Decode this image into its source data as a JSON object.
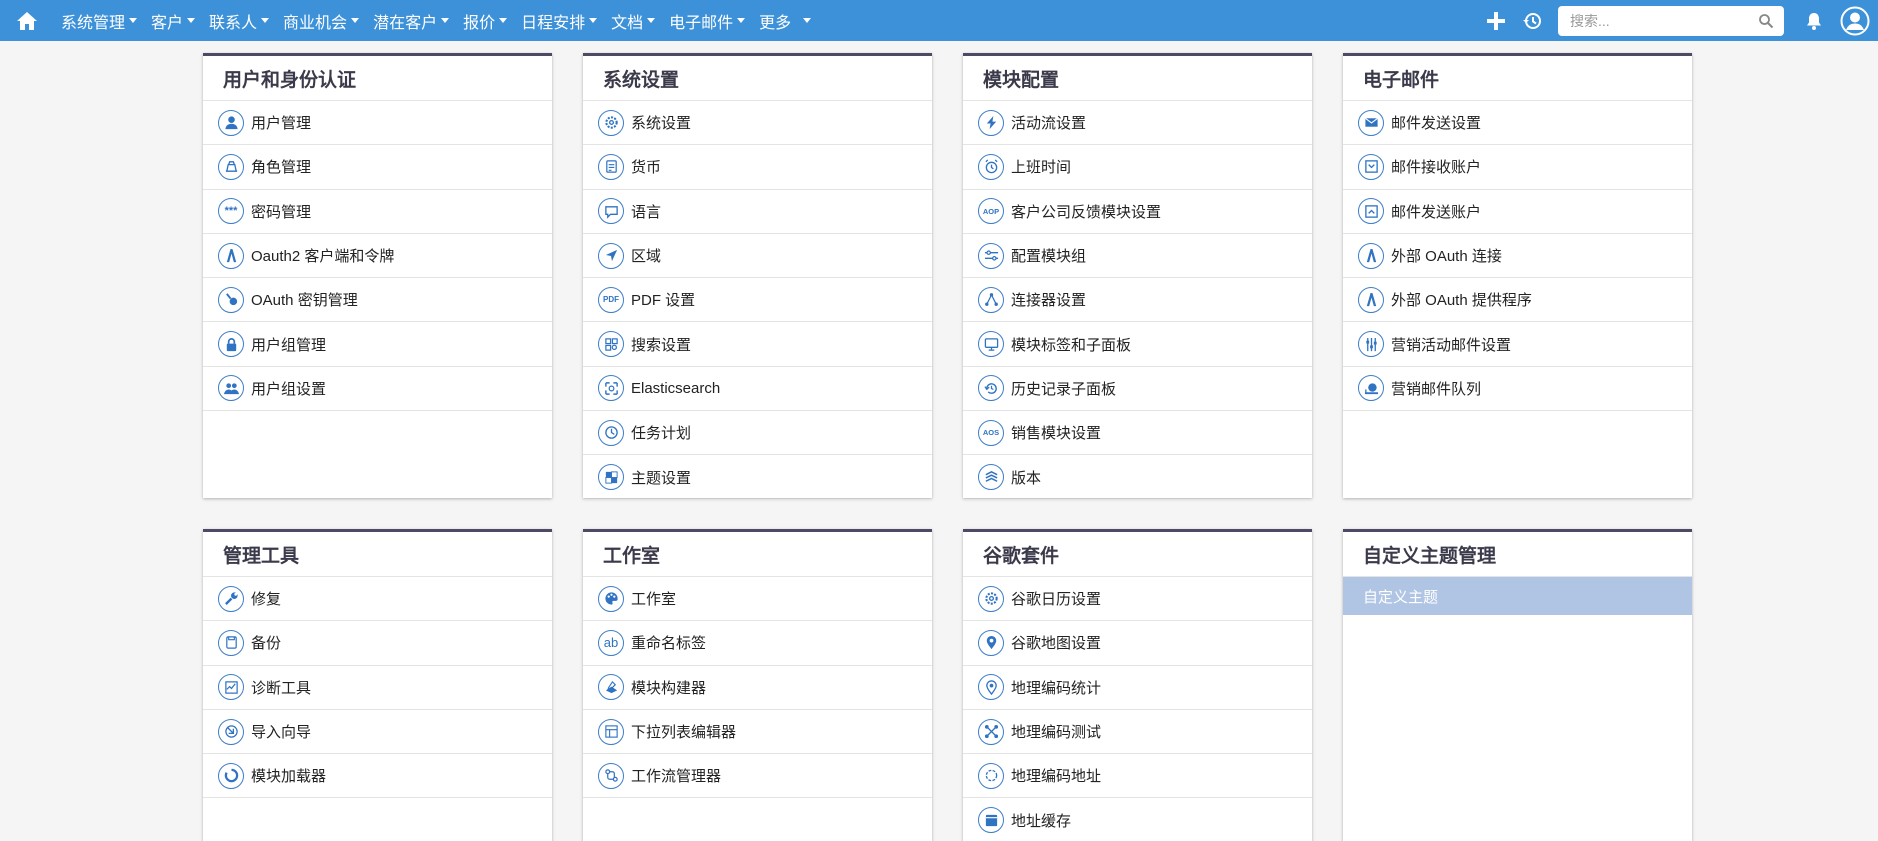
{
  "nav": {
    "menus": [
      "系统管理",
      "客户",
      "联系人",
      "商业机会",
      "潜在客户",
      "报价",
      "日程安排",
      "文档",
      "电子邮件",
      "更多"
    ],
    "search_placeholder": "搜索..."
  },
  "panels": [
    {
      "title": "用户和身份认证",
      "items": [
        {
          "label": "用户管理",
          "icon": "user-icon"
        },
        {
          "label": "角色管理",
          "icon": "role-icon"
        },
        {
          "label": "密码管理",
          "icon": "password-icon"
        },
        {
          "label": "Oauth2 客户端和令牌",
          "icon": "oauth-client-icon"
        },
        {
          "label": "OAuth 密钥管理",
          "icon": "key-icon"
        },
        {
          "label": "用户组管理",
          "icon": "lock-icon"
        },
        {
          "label": "用户组设置",
          "icon": "group-icon"
        }
      ]
    },
    {
      "title": "系统设置",
      "items": [
        {
          "label": "系统设置",
          "icon": "gear-icon"
        },
        {
          "label": "货币",
          "icon": "currency-icon"
        },
        {
          "label": "语言",
          "icon": "speech-bubble-icon"
        },
        {
          "label": "区域",
          "icon": "location-arrow-icon"
        },
        {
          "label": "PDF 设置",
          "icon": "pdf-icon"
        },
        {
          "label": "搜索设置",
          "icon": "search-settings-icon"
        },
        {
          "label": "Elasticsearch",
          "icon": "elasticsearch-icon"
        },
        {
          "label": "任务计划",
          "icon": "clock-icon"
        },
        {
          "label": "主题设置",
          "icon": "theme-icon"
        }
      ]
    },
    {
      "title": "模块配置",
      "items": [
        {
          "label": "活动流设置",
          "icon": "lightning-icon"
        },
        {
          "label": "上班时间",
          "icon": "alarm-clock-icon"
        },
        {
          "label": "客户公司反馈模块设置",
          "icon": "aop-icon"
        },
        {
          "label": "配置模块组",
          "icon": "sliders-icon"
        },
        {
          "label": "连接器设置",
          "icon": "connector-icon"
        },
        {
          "label": "模块标签和子面板",
          "icon": "monitor-icon"
        },
        {
          "label": "历史记录子面板",
          "icon": "history-icon"
        },
        {
          "label": "销售模块设置",
          "icon": "aos-icon"
        },
        {
          "label": "版本",
          "icon": "layers-icon"
        }
      ]
    },
    {
      "title": "电子邮件",
      "items": [
        {
          "label": "邮件发送设置",
          "icon": "envelope-icon"
        },
        {
          "label": "邮件接收账户",
          "icon": "inbox-icon"
        },
        {
          "label": "邮件发送账户",
          "icon": "outbox-icon"
        },
        {
          "label": "外部 OAuth 连接",
          "icon": "oauth-connect-icon"
        },
        {
          "label": "外部 OAuth 提供程序",
          "icon": "oauth-provider-icon"
        },
        {
          "label": "营销活动邮件设置",
          "icon": "campaign-sliders-icon"
        },
        {
          "label": "营销邮件队列",
          "icon": "snail-icon"
        }
      ]
    },
    {
      "title": "管理工具",
      "items": [
        {
          "label": "修复",
          "icon": "wrench-icon"
        },
        {
          "label": "备份",
          "icon": "backup-icon"
        },
        {
          "label": "诊断工具",
          "icon": "diagnostic-icon"
        },
        {
          "label": "导入向导",
          "icon": "import-icon"
        },
        {
          "label": "模块加载器",
          "icon": "loader-icon"
        }
      ]
    },
    {
      "title": "工作室",
      "items": [
        {
          "label": "工作室",
          "icon": "palette-icon"
        },
        {
          "label": "重命名标签",
          "icon": "ab-icon"
        },
        {
          "label": "模块构建器",
          "icon": "builder-icon"
        },
        {
          "label": "下拉列表编辑器",
          "icon": "dropdown-icon"
        },
        {
          "label": "工作流管理器",
          "icon": "workflow-icon"
        }
      ]
    },
    {
      "title": "谷歌套件",
      "items": [
        {
          "label": "谷歌日历设置",
          "icon": "calendar-gear-icon"
        },
        {
          "label": "谷歌地图设置",
          "icon": "map-pin-icon"
        },
        {
          "label": "地理编码统计",
          "icon": "geo-stats-icon"
        },
        {
          "label": "地理编码测试",
          "icon": "geo-test-icon"
        },
        {
          "label": "地理编码地址",
          "icon": "geo-address-icon"
        },
        {
          "label": "地址缓存",
          "icon": "cache-icon"
        }
      ]
    },
    {
      "title": "自定义主题管理",
      "items": [
        {
          "label": "自定义主题",
          "icon": ""
        }
      ]
    }
  ],
  "colors": {
    "nav_bg": "#3d91d9",
    "icon": "#2f73c2",
    "panel_border": "#4e4a63",
    "theme_highlight": "#b0c4e4"
  }
}
